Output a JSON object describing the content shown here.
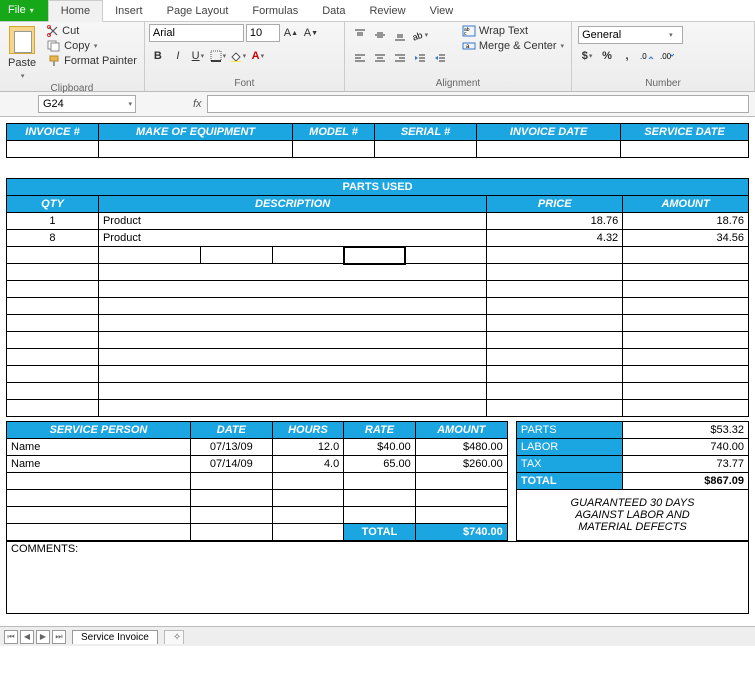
{
  "tabs": {
    "file": "File",
    "home": "Home",
    "insert": "Insert",
    "pagelayout": "Page Layout",
    "formulas": "Formulas",
    "data": "Data",
    "review": "Review",
    "view": "View"
  },
  "clipboard": {
    "paste": "Paste",
    "cut": "Cut",
    "copy": "Copy",
    "fmt": "Format Painter",
    "group": "Clipboard"
  },
  "font": {
    "name": "Arial",
    "size": "10",
    "group": "Font"
  },
  "alignment": {
    "wrap": "Wrap Text",
    "merge": "Merge & Center",
    "group": "Alignment"
  },
  "number": {
    "format": "General",
    "group": "Number"
  },
  "namebox": "G24",
  "fx": "fx",
  "inv_hdr": {
    "invno": "INVOICE #",
    "make": "MAKE OF EQUIPMENT",
    "model": "MODEL #",
    "serial": "SERIAL #",
    "invdate": "INVOICE DATE",
    "svcdate": "SERVICE DATE"
  },
  "parts_title": "PARTS USED",
  "parts_hdr": {
    "qty": "QTY",
    "desc": "DESCRIPTION",
    "price": "PRICE",
    "amount": "AMOUNT"
  },
  "parts": [
    {
      "qty": "1",
      "desc": "Product",
      "price": "18.76",
      "amount": "18.76"
    },
    {
      "qty": "8",
      "desc": "Product",
      "price": "4.32",
      "amount": "34.56"
    }
  ],
  "svc_hdr": {
    "person": "SERVICE PERSON",
    "date": "DATE",
    "hours": "HOURS",
    "rate": "RATE",
    "amount": "AMOUNT"
  },
  "svc": [
    {
      "person": "Name",
      "date": "07/13/09",
      "hours": "12.0",
      "rate": "$40.00",
      "amount": "$480.00"
    },
    {
      "person": "Name",
      "date": "07/14/09",
      "hours": "4.0",
      "rate": "65.00",
      "amount": "$260.00"
    }
  ],
  "svc_total_label": "TOTAL",
  "svc_total_value": "$740.00",
  "summary": {
    "parts_l": "PARTS",
    "parts_v": "$53.32",
    "labor_l": "LABOR",
    "labor_v": "740.00",
    "tax_l": "TAX",
    "tax_v": "73.77",
    "total_l": "TOTAL",
    "total_v": "$867.09"
  },
  "guarantee": {
    "l1": "GUARANTEED 30 DAYS",
    "l2": "AGAINST LABOR AND",
    "l3": "MATERIAL DEFECTS"
  },
  "comments_label": "COMMENTS:",
  "sheet_tab": "Service Invoice"
}
